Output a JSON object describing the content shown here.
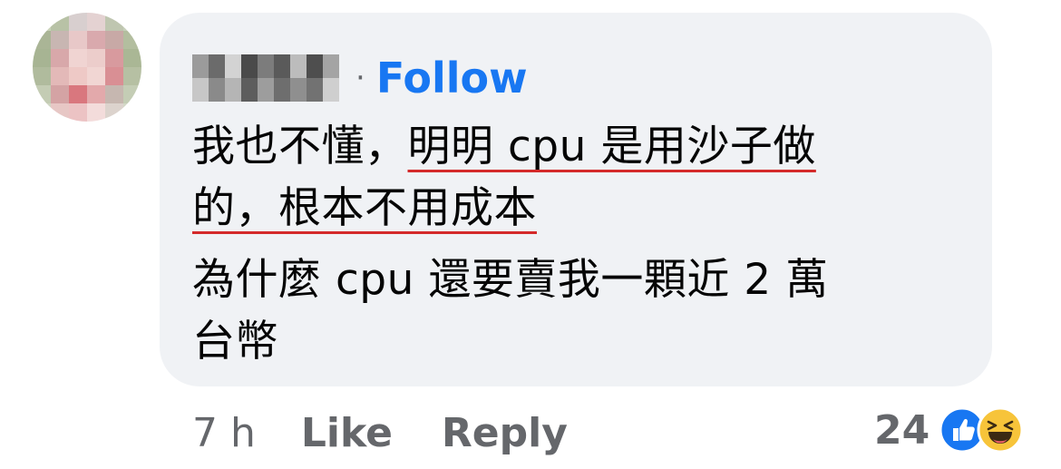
{
  "comment": {
    "author_name": "",
    "separator": "·",
    "follow_label": "Follow",
    "text_lines": {
      "line1_a": "我也不懂，",
      "line1_b": "明明 cpu 是用沙子做",
      "line2": "的，根本不用成本",
      "line3": "為什麼 cpu 還要賣我一顆近 2 萬",
      "line4": "台幣"
    }
  },
  "actions": {
    "time": "7 h",
    "like_label": "Like",
    "reply_label": "Reply"
  },
  "reactions": {
    "count": "24",
    "icons": [
      "like-icon",
      "haha-icon"
    ]
  },
  "colors": {
    "bubble": "#f0f2f5",
    "link_blue": "#1877f2",
    "meta_gray": "#65676b",
    "underline_red": "#d42a2a"
  }
}
